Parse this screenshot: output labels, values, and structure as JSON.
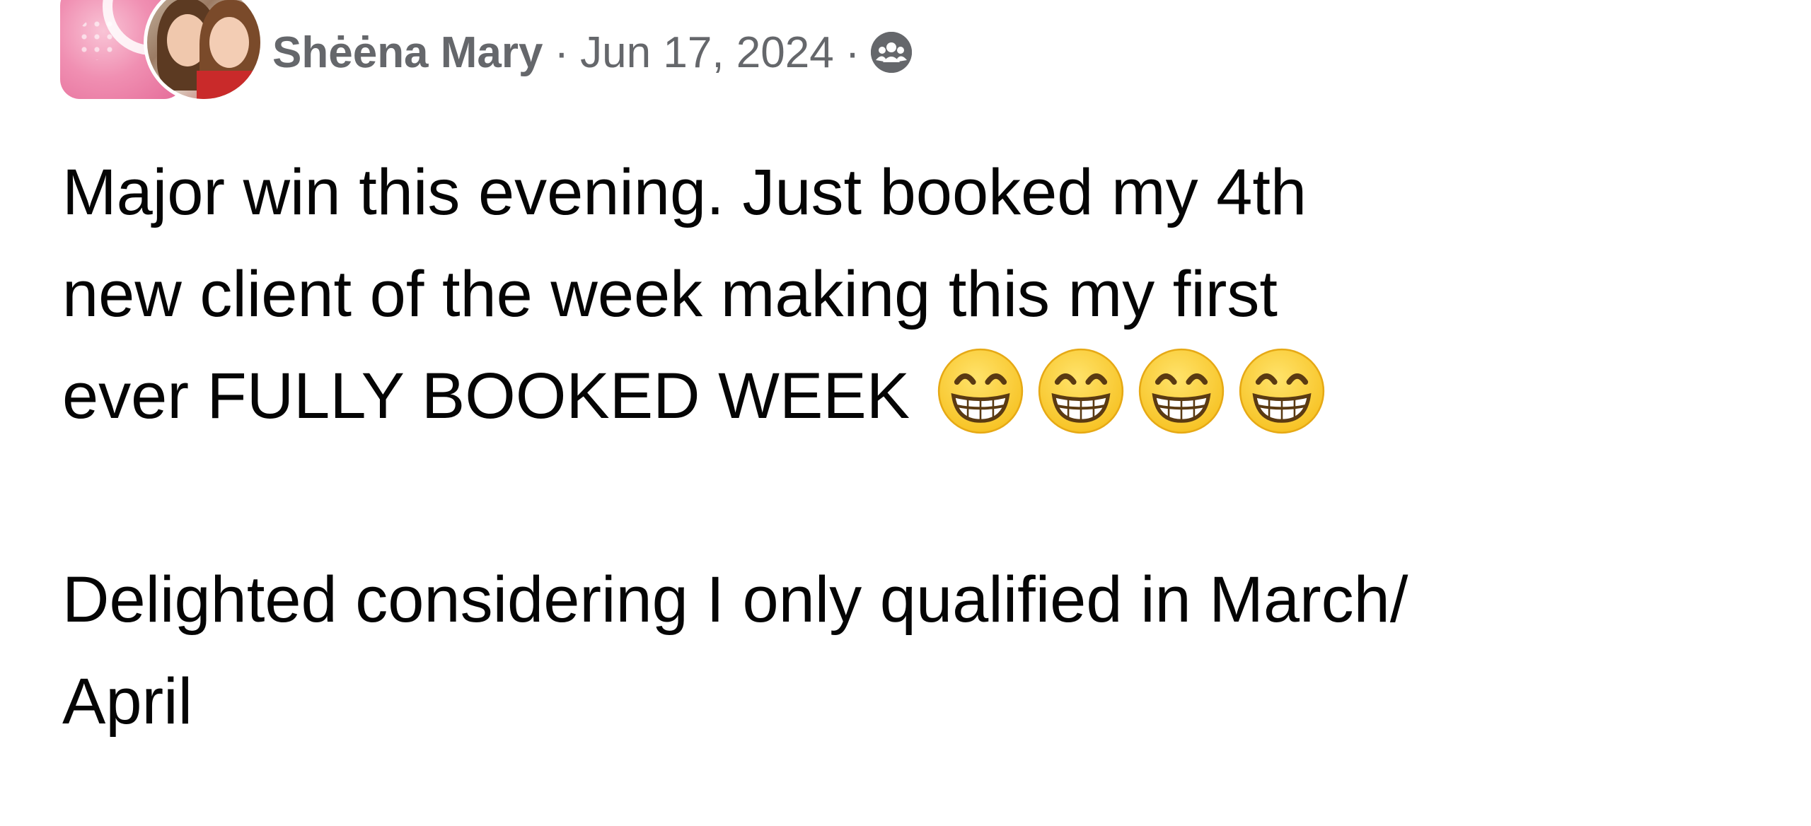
{
  "post": {
    "author": "Shėėna Mary",
    "separator": "·",
    "date": "Jun 17, 2024",
    "audience_icon": "group-icon",
    "body_lines": [
      "Major win this evening. Just booked my 4th",
      "new client of the week making this my first",
      "ever FULLY BOOKED WEEK"
    ],
    "emoji": "grinning-face-with-smiling-eyes",
    "emoji_count": 4,
    "body_lines_2": [
      "Delighted considering I only qualified in March/",
      "April"
    ]
  },
  "colors": {
    "meta_text": "#65676b",
    "body_text": "#050505",
    "emoji_face": "#f7c325",
    "group_avatar": "#e46a97"
  }
}
